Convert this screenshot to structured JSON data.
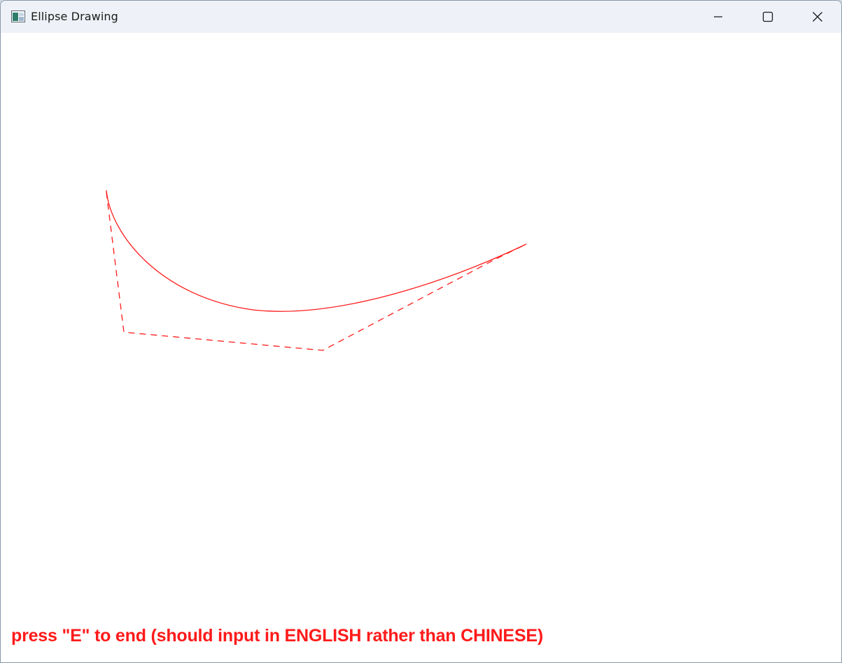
{
  "window": {
    "title": "Ellipse Drawing",
    "icon": "app-window-icon"
  },
  "controls": {
    "minimize_icon": "minimize-icon",
    "maximize_icon": "maximize-icon",
    "close_icon": "close-icon"
  },
  "canvas": {
    "stroke_color": "#ff1a1a",
    "hint_text": "press \"E\" to end (should input in ENGLISH rather than CHINESE)"
  }
}
